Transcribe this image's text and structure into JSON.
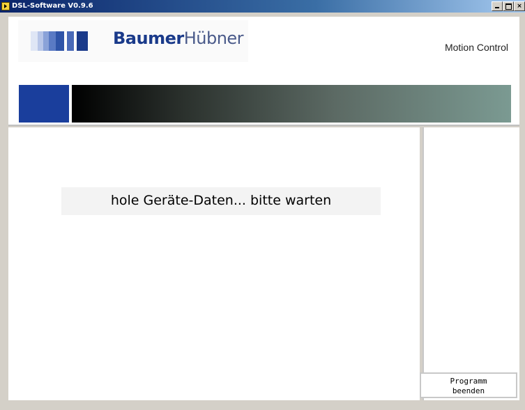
{
  "window": {
    "title": "DSL-Software V0.9.6"
  },
  "header": {
    "logo_bold": "Baumer",
    "logo_light": "Hübner",
    "tagline": "Motion Control"
  },
  "main": {
    "status_message": "hole Geräte-Daten... bitte warten"
  },
  "side": {
    "quit_button_line1": "Programm",
    "quit_button_line2": "beenden"
  },
  "colors": {
    "brand_blue": "#1a3e9c",
    "logo_text": "#1a3a8a",
    "titlebar": "#0a246a"
  },
  "icons": {
    "app_icon": "app-icon",
    "minimize": "minimize-icon",
    "maximize": "maximize-icon",
    "close": "close-icon"
  }
}
